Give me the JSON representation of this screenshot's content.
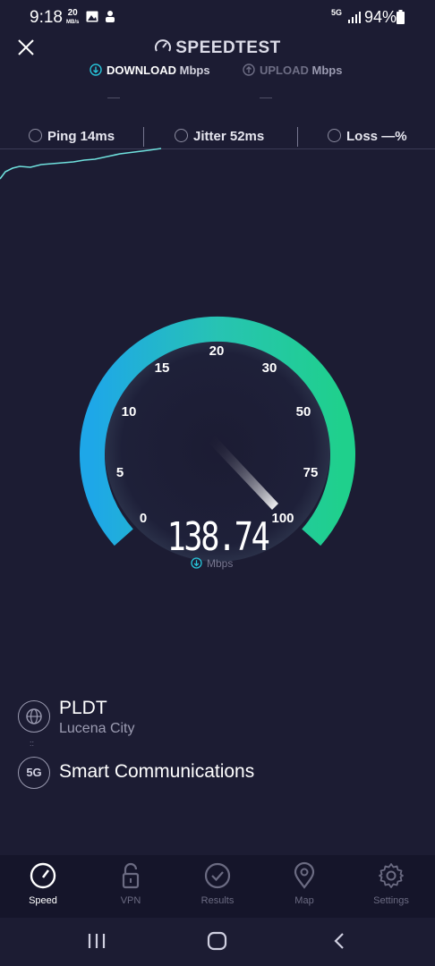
{
  "status_bar": {
    "time": "9:18",
    "net_speed_value": "20",
    "net_speed_unit": "MB/s",
    "net_type": "5G",
    "battery": "94%"
  },
  "header": {
    "title": "SPEEDTEST",
    "download_label": "DOWNLOAD",
    "download_unit": "Mbps",
    "upload_label": "UPLOAD",
    "upload_unit": "Mbps",
    "download_value": "—",
    "upload_value": "—"
  },
  "metrics": {
    "ping_label": "Ping",
    "ping_value": "14ms",
    "jitter_label": "Jitter",
    "jitter_value": "52ms",
    "loss_label": "Loss",
    "loss_value": "—%"
  },
  "gauge": {
    "ticks": [
      "0",
      "5",
      "10",
      "15",
      "20",
      "30",
      "50",
      "75",
      "100"
    ],
    "speed": "138.74",
    "unit": "Mbps",
    "colors": {
      "start": "#1ea7e8",
      "mid": "#27c3b3",
      "end": "#1fd08c"
    }
  },
  "connection": {
    "isp": "PLDT",
    "location": "Lucena City",
    "carrier_badge": "5G",
    "carrier": "Smart Communications"
  },
  "nav": {
    "items": [
      {
        "label": "Speed",
        "icon": "speedometer-icon",
        "active": true
      },
      {
        "label": "VPN",
        "icon": "lock-icon",
        "active": false
      },
      {
        "label": "Results",
        "icon": "check-circle-icon",
        "active": false
      },
      {
        "label": "Map",
        "icon": "map-pin-icon",
        "active": false
      },
      {
        "label": "Settings",
        "icon": "gear-icon",
        "active": false
      }
    ]
  }
}
